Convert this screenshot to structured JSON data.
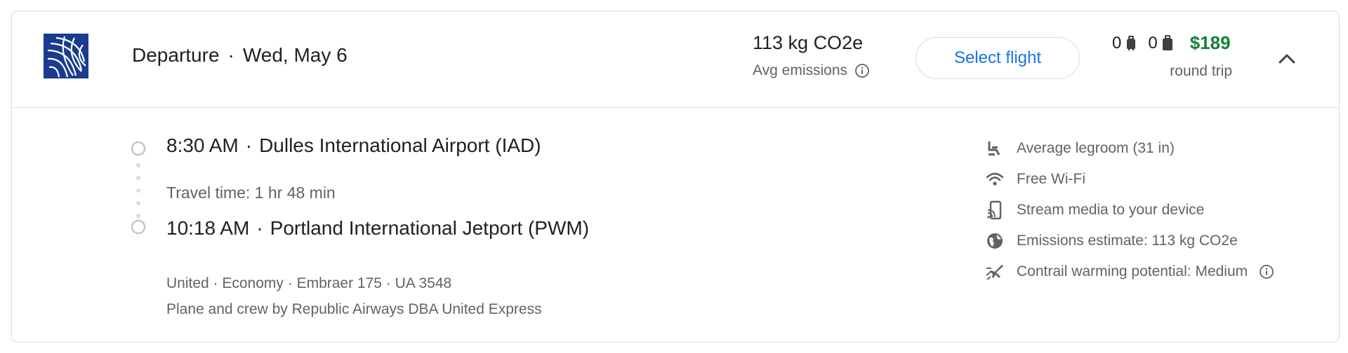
{
  "header": {
    "airline_logo_icon": "united-globe-logo",
    "direction": "Departure",
    "date": "Wed, May 6",
    "separator": "·",
    "emissions_value": "113 kg CO2e",
    "emissions_label": "Avg emissions",
    "select_label": "Select flight",
    "carry_on_count": "0",
    "checked_bag_count": "0",
    "price": "$189",
    "price_note": "round trip",
    "colors": {
      "price": "#188038",
      "accent": "#1a73e8",
      "logo": "#1a3c8e"
    }
  },
  "segment": {
    "departure_time": "8:30 AM",
    "departure_airport": "Dulles International Airport (IAD)",
    "travel_time": "Travel time: 1 hr 48 min",
    "arrival_time": "10:18 AM",
    "arrival_airport": "Portland International Jetport (PWM)",
    "details": "United · Economy · Embraer 175 · UA 3548",
    "operator": "Plane and crew by Republic Airways DBA United Express"
  },
  "amenities": [
    {
      "icon": "seat-legroom-icon",
      "label": "Average legroom (31 in)"
    },
    {
      "icon": "wifi-icon",
      "label": "Free Wi-Fi"
    },
    {
      "icon": "stream-media-icon",
      "label": "Stream media to your device"
    },
    {
      "icon": "globe-emissions-icon",
      "label": "Emissions estimate: 113 kg CO2e"
    },
    {
      "icon": "contrail-plane-icon",
      "label": "Contrail warming potential: Medium"
    }
  ]
}
